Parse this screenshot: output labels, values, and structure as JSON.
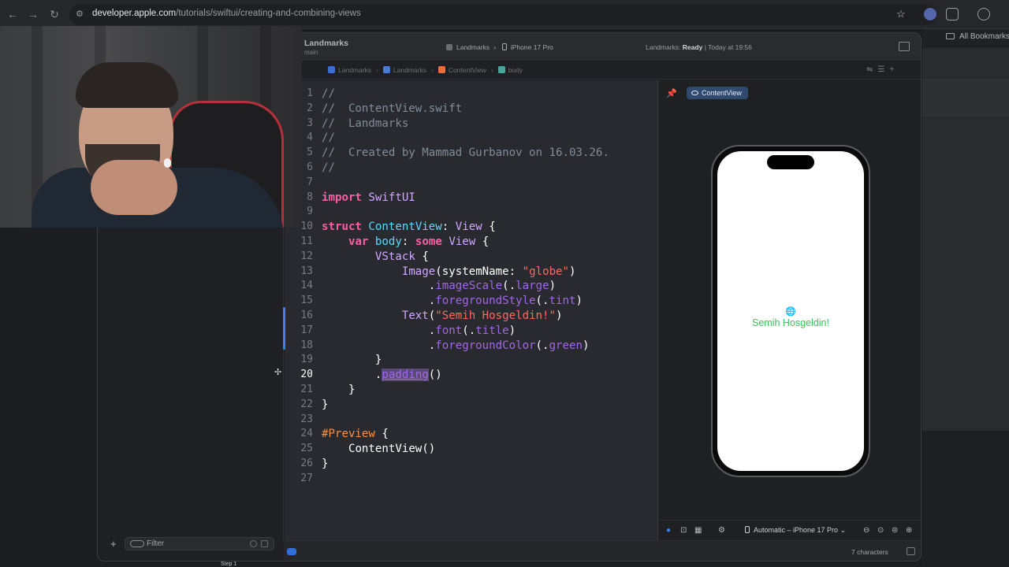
{
  "browser": {
    "url_host": "developer.apple.com",
    "url_path": "/tutorials/swiftui/creating-and-combining-views",
    "bookmarks_label": "All Bookmarks"
  },
  "xcode": {
    "project_name": "Landmarks",
    "branch": "main",
    "scheme_target": "Landmarks",
    "scheme_device": "iPhone 17 Pro",
    "status_prefix": "Landmarks:",
    "status_state": "Ready",
    "status_suffix": "| Today at 19:56",
    "breadcrumbs": [
      "Landmarks",
      "Landmarks",
      "ContentView",
      "body"
    ],
    "preview_chip": "ContentView",
    "preview_text": "Semih Hosgeldin!",
    "device_selector": "Automatic – iPhone 17 Pro",
    "char_count": "7 characters",
    "filter_placeholder": "Filter",
    "bottom_peek": "Step 1"
  },
  "code": {
    "current_line": 20,
    "lines": [
      "//",
      "//  ContentView.swift",
      "//  Landmarks",
      "//",
      "//  Created by Mammad Gurbanov on 16.03.26.",
      "//",
      "",
      "import SwiftUI",
      "",
      "struct ContentView: View {",
      "    var body: some View {",
      "        VStack {",
      "            Image(systemName: \"globe\")",
      "                .imageScale(.large)",
      "                .foregroundStyle(.tint)",
      "            Text(\"Semih Hosgeldin!\")",
      "                .font(.title)",
      "                .foregroundColor(.green)",
      "        }",
      "        .padding()",
      "    }",
      "}",
      "",
      "#Preview {",
      "    ContentView()",
      "}",
      ""
    ]
  },
  "colors": {
    "keyword": "#fc5fa3",
    "string": "#fc6a5d",
    "comment": "#7f8c98",
    "preview_text": "#34c759",
    "accent": "#3b82f6"
  }
}
